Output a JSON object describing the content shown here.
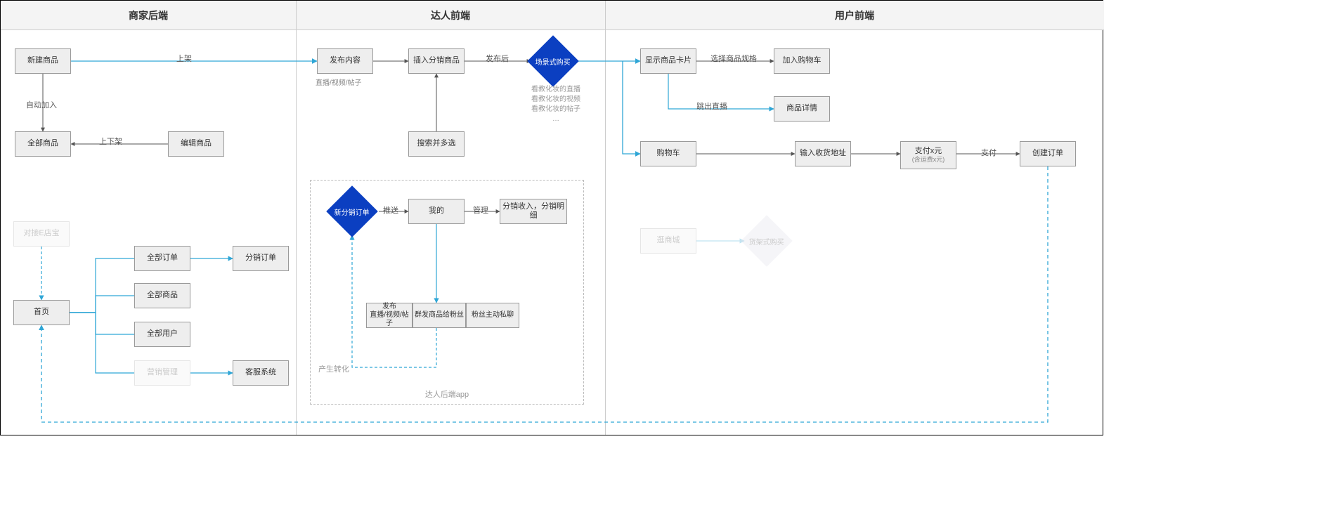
{
  "lanes": {
    "merchant": "商家后端",
    "creator": "达人前端",
    "user": "用户前端"
  },
  "merchant": {
    "new_product": "新建商品",
    "all_products": "全部商品",
    "edit_product": "编辑商品",
    "edge_auto_join": "自动加入",
    "edge_shelf": "上下架",
    "edge_list": "上架",
    "edianbao": "对接E店宝",
    "home": "首页",
    "all_orders": "全部订单",
    "all_products2": "全部商品",
    "all_users": "全部用户",
    "marketing": "营销管理",
    "dist_orders": "分销订单",
    "cs_system": "客服系统"
  },
  "creator": {
    "publish": "发布内容",
    "publish_sub": "直播/视频/帖子",
    "insert_goods": "插入分销商品",
    "search_select": "搜索并多选",
    "edge_after_publish": "发布后",
    "scene_buy": "场景式购买",
    "scene_note_1": "看教化妆的直播",
    "scene_note_2": "看教化妆的视频",
    "scene_note_3": "看教化妆的帖子",
    "scene_note_4": "…",
    "new_dist_order": "新分销订单",
    "edge_push": "推送",
    "mine": "我的",
    "edge_manage": "管理",
    "dist_income": "分销收入，分销明细",
    "pub_live": "发布\n直播/视频/帖子",
    "mass_send": "群发商品给粉丝",
    "fan_dm": "粉丝主动私聊",
    "edge_convert": "产生转化",
    "group_label": "达人后端app"
  },
  "user": {
    "show_card": "显示商品卡片",
    "edge_select_spec": "选择商品规格",
    "add_cart": "加入购物车",
    "edge_jump_live": "跳出直播",
    "product_detail": "商品详情",
    "cart": "购物车",
    "input_addr": "输入收货地址",
    "pay": "支付x元",
    "pay_sub": "(含运费x元)",
    "edge_pay": "支付",
    "create_order": "创建订单",
    "back_mall": "逛商城",
    "shelf_buy": "货架式购买"
  }
}
